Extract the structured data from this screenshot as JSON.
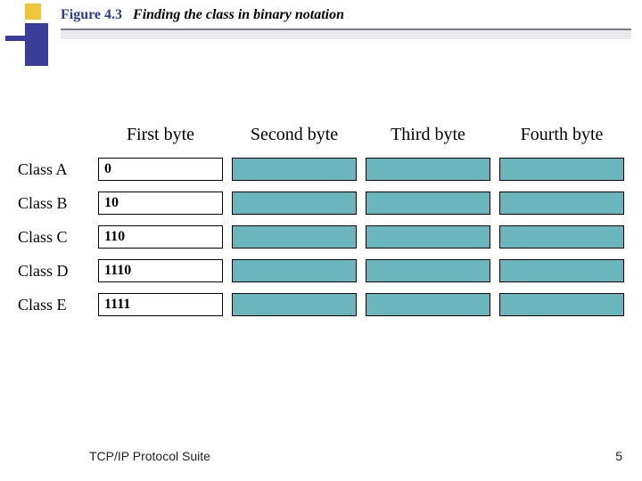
{
  "figure": {
    "number": "Figure 4.3",
    "title": "Finding the class in binary notation"
  },
  "columns": [
    "First byte",
    "Second byte",
    "Third byte",
    "Fourth byte"
  ],
  "rows": [
    {
      "label": "Class A",
      "prefix": "0"
    },
    {
      "label": "Class B",
      "prefix": "10"
    },
    {
      "label": "Class C",
      "prefix": "110"
    },
    {
      "label": "Class D",
      "prefix": "1110"
    },
    {
      "label": "Class E",
      "prefix": "1111"
    }
  ],
  "footer": {
    "text": "TCP/IP Protocol Suite",
    "page": "5"
  }
}
